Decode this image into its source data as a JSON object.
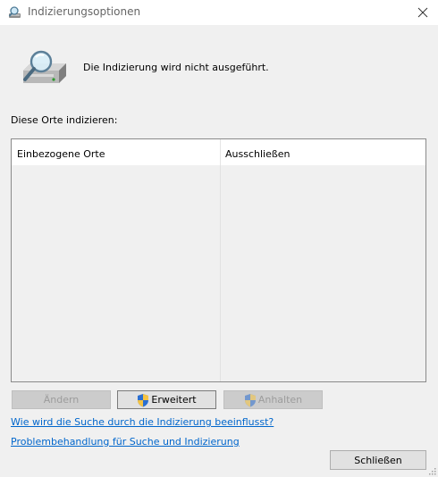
{
  "window": {
    "title": "Indizierungsoptionen",
    "icon": "magnifier-drive-icon"
  },
  "status": {
    "text": "Die Indizierung wird nicht ausgeführt.",
    "icon": "drive-magnifier-icon"
  },
  "list": {
    "label": "Diese Orte indizieren:",
    "columns": [
      "Einbezogene Orte",
      "Ausschließen"
    ],
    "rows": []
  },
  "buttons": {
    "aendern": "Ändern",
    "erweitert": "Erweitert",
    "anhalten": "Anhalten",
    "schliessen": "Schließen"
  },
  "links": {
    "search_affected": "Wie wird die Suche durch die Indizierung beeinflusst?",
    "troubleshoot": "Problembehandlung für Suche und Indizierung"
  },
  "colors": {
    "link": "#0066cc",
    "shield_blue": "#2b6fd1",
    "shield_yellow": "#f5c342"
  }
}
